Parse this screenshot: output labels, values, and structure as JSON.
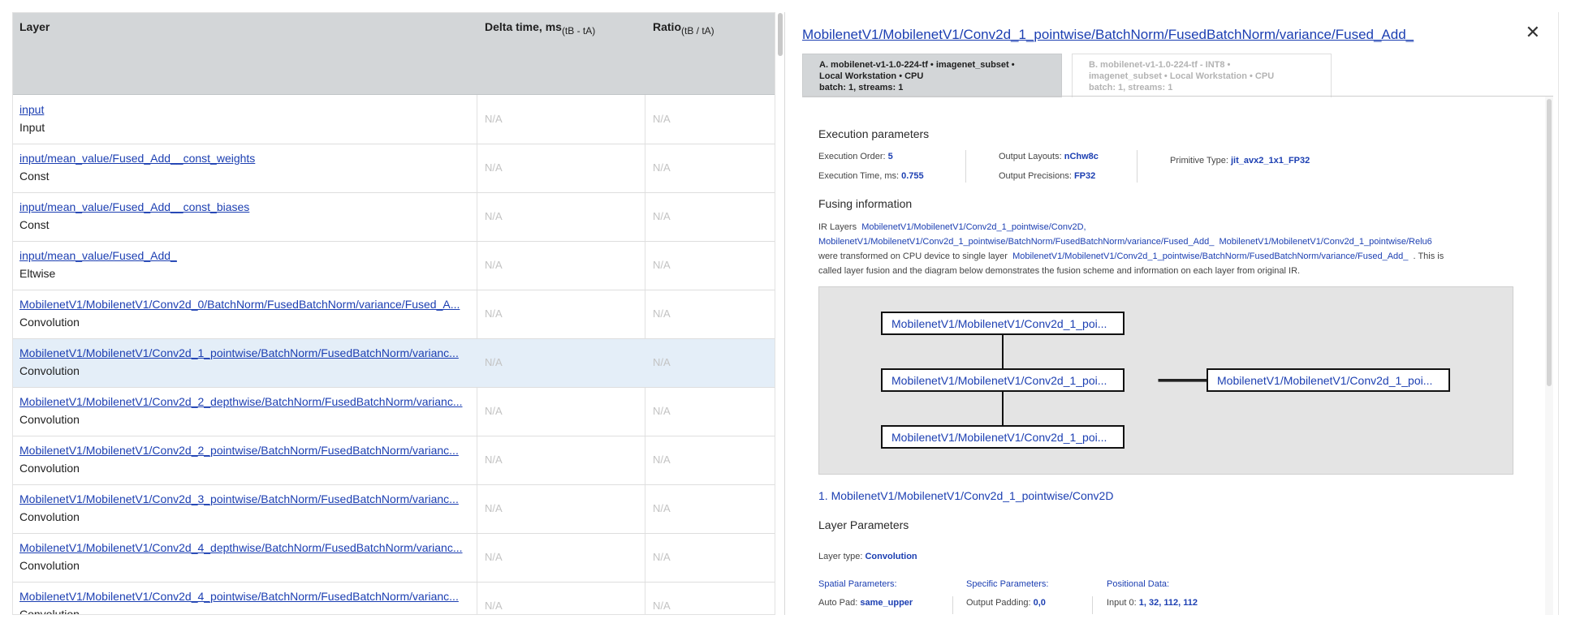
{
  "table": {
    "headers": {
      "layer": "Layer",
      "delta": "Delta time, ms",
      "delta_sub": "(tB - tA)",
      "ratio": "Ratio",
      "ratio_sub": "(tB / tA)"
    },
    "rows": [
      {
        "name": "input",
        "type": "Input",
        "delta": "N/A",
        "ratio": "N/A"
      },
      {
        "name": "input/mean_value/Fused_Add__const_weights",
        "type": "Const",
        "delta": "N/A",
        "ratio": "N/A"
      },
      {
        "name": "input/mean_value/Fused_Add__const_biases",
        "type": "Const",
        "delta": "N/A",
        "ratio": "N/A"
      },
      {
        "name": "input/mean_value/Fused_Add_",
        "type": "Eltwise",
        "delta": "N/A",
        "ratio": "N/A"
      },
      {
        "name": "MobilenetV1/MobilenetV1/Conv2d_0/BatchNorm/FusedBatchNorm/variance/Fused_A...",
        "type": "Convolution",
        "delta": "N/A",
        "ratio": "N/A"
      },
      {
        "name": "MobilenetV1/MobilenetV1/Conv2d_1_pointwise/BatchNorm/FusedBatchNorm/varianc...",
        "type": "Convolution",
        "delta": "N/A",
        "ratio": "N/A"
      },
      {
        "name": "MobilenetV1/MobilenetV1/Conv2d_2_depthwise/BatchNorm/FusedBatchNorm/varianc...",
        "type": "Convolution",
        "delta": "N/A",
        "ratio": "N/A"
      },
      {
        "name": "MobilenetV1/MobilenetV1/Conv2d_2_pointwise/BatchNorm/FusedBatchNorm/varianc...",
        "type": "Convolution",
        "delta": "N/A",
        "ratio": "N/A"
      },
      {
        "name": "MobilenetV1/MobilenetV1/Conv2d_3_pointwise/BatchNorm/FusedBatchNorm/varianc...",
        "type": "Convolution",
        "delta": "N/A",
        "ratio": "N/A"
      },
      {
        "name": "MobilenetV1/MobilenetV1/Conv2d_4_depthwise/BatchNorm/FusedBatchNorm/varianc...",
        "type": "Convolution",
        "delta": "N/A",
        "ratio": "N/A"
      },
      {
        "name": "MobilenetV1/MobilenetV1/Conv2d_4_pointwise/BatchNorm/FusedBatchNorm/varianc...",
        "type": "Convolution",
        "delta": "N/A",
        "ratio": "N/A"
      }
    ]
  },
  "detail": {
    "title": "MobilenetV1/MobilenetV1/Conv2d_1_pointwise/BatchNorm/FusedBatchNorm/variance/Fused_Add_",
    "close_icon": "close-icon",
    "tab_a": {
      "line1": "A. mobilenet-v1-1.0-224-tf • imagenet_subset •",
      "line2": "Local Workstation • CPU",
      "line3": "batch: 1, streams: 1"
    },
    "tab_b": {
      "line1": "B. mobilenet-v1-1.0-224-tf - INT8 •",
      "line2": "imagenet_subset • Local Workstation • CPU",
      "line3": "batch: 1, streams: 1"
    },
    "exec": {
      "title": "Execution parameters",
      "order_label": "Execution Order:",
      "order_value": "5",
      "time_label": "Execution Time, ms:",
      "time_value": "0.755",
      "layouts_label": "Output Layouts:",
      "layouts_value": "nChw8c",
      "precisions_label": "Output Precisions:",
      "precisions_value": "FP32",
      "primitive_label": "Primitive Type:",
      "primitive_value": "jit_avx2_1x1_FP32"
    },
    "fusing": {
      "title": "Fusing information",
      "ir_label": "IR Layers",
      "ir_layer_1": "MobilenetV1/MobilenetV1/Conv2d_1_pointwise/Conv2D,",
      "ir_layer_2": "MobilenetV1/MobilenetV1/Conv2d_1_pointwise/BatchNorm/FusedBatchNorm/variance/Fused_Add_",
      "ir_layer_3": "MobilenetV1/MobilenetV1/Conv2d_1_pointwise/Relu6",
      "transformed_text": "were transformed on CPU device to single layer",
      "single_layer": "MobilenetV1/MobilenetV1/Conv2d_1_pointwise/BatchNorm/FusedBatchNorm/variance/Fused_Add_",
      "tail_text": ". This is",
      "tail_text_2": "called layer fusion and the diagram below demonstrates the fusion scheme and information on each layer from original IR.",
      "diagram_nodes": [
        "MobilenetV1/MobilenetV1/Conv2d_1_poi...",
        "MobilenetV1/MobilenetV1/Conv2d_1_poi...",
        "MobilenetV1/MobilenetV1/Conv2d_1_poi..."
      ],
      "diagram_result": "MobilenetV1/MobilenetV1/Conv2d_1_poi...",
      "arrow": "🡒"
    },
    "layer_link": "1. MobilenetV1/MobilenetV1/Conv2d_1_pointwise/Conv2D",
    "layer_params": {
      "title": "Layer Parameters",
      "type_label": "Layer type:",
      "type_value": "Convolution",
      "spatial_label": "Spatial Parameters:",
      "specific_label": "Specific Parameters:",
      "positional_label": "Positional Data:",
      "autopad_label": "Auto Pad:",
      "autopad_value": "same_upper",
      "outpad_label": "Output Padding:",
      "outpad_value": "0,0",
      "input0_label": "Input 0:",
      "input0_value": "1, 32, 112, 112"
    }
  }
}
